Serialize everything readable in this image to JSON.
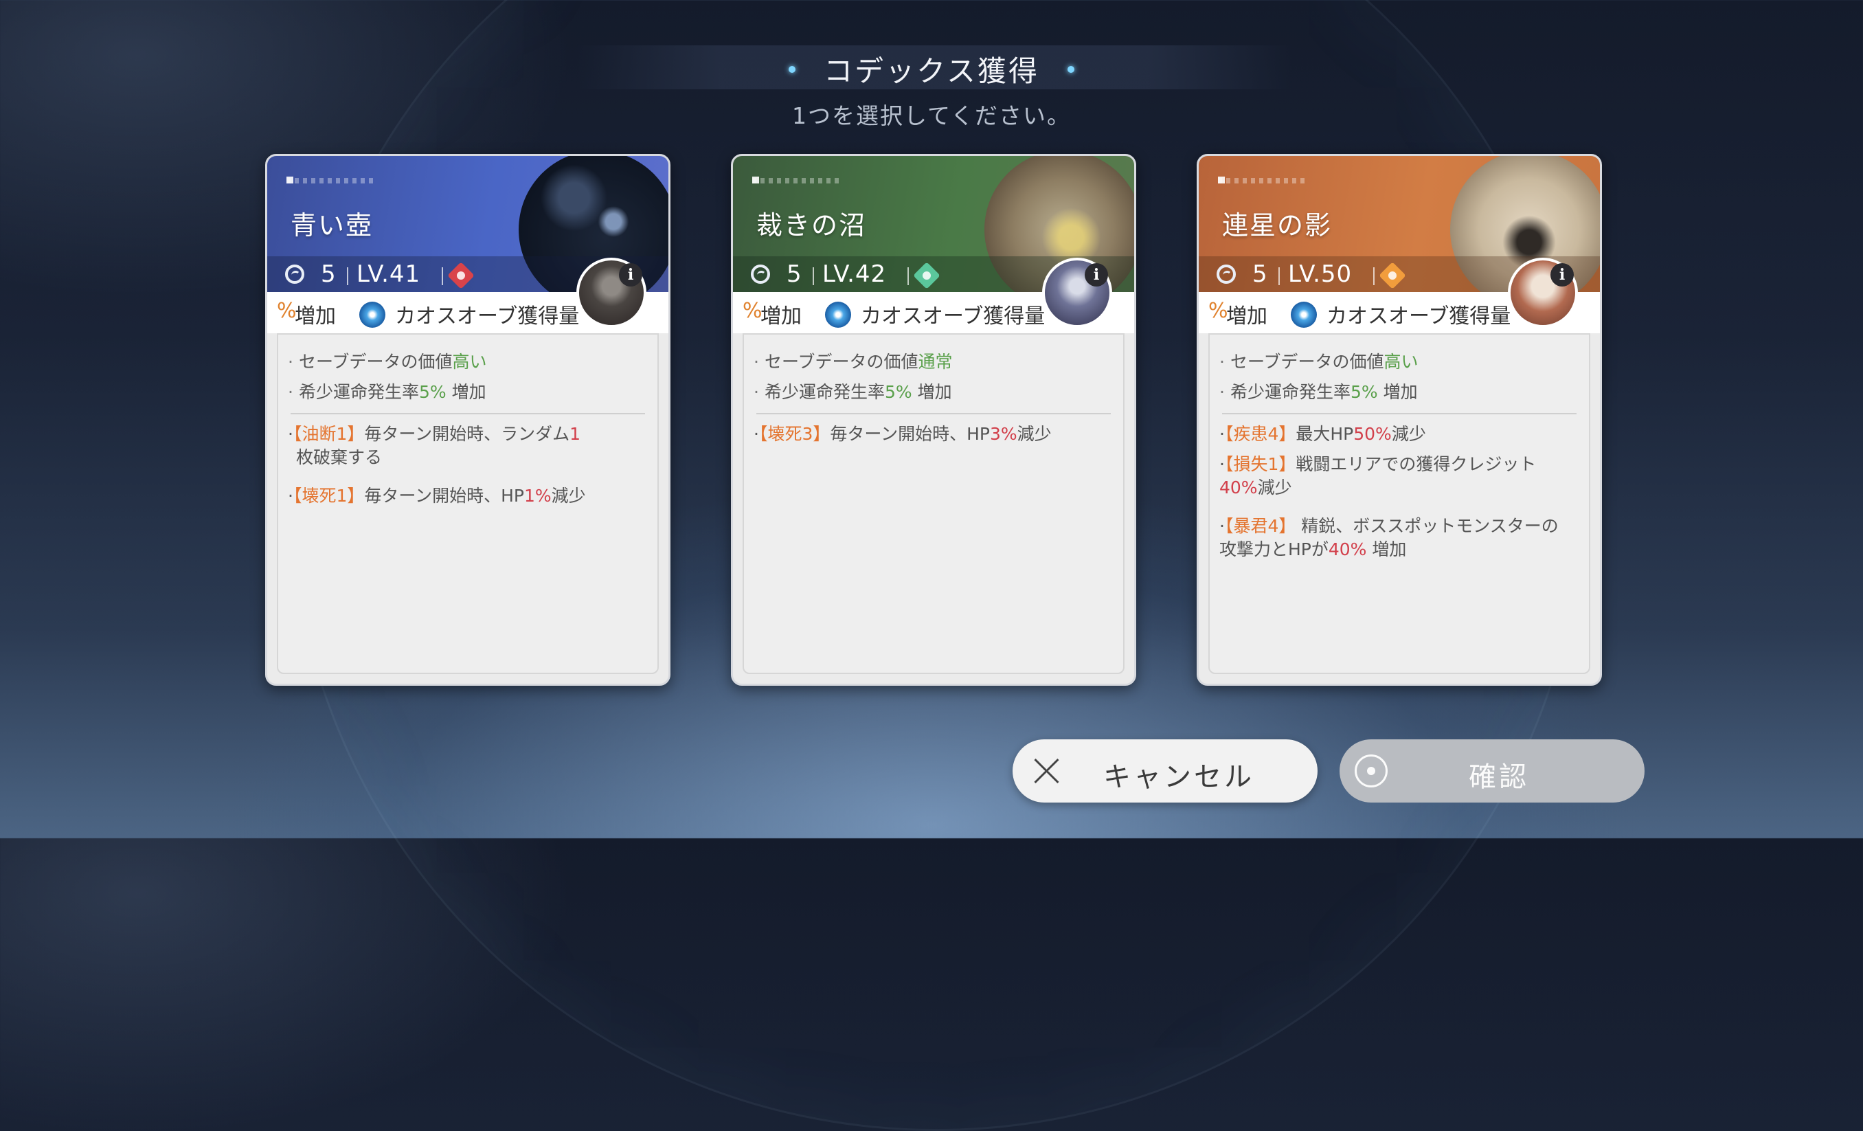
{
  "header": {
    "title": "コデックス獲得",
    "subtitle": "1つを選択してください。"
  },
  "cards": [
    {
      "name": "青い壺",
      "rarity": "5",
      "level": "LV.41",
      "element_color": "#d9434a",
      "strip_pct": "%",
      "strip_increase": "増加",
      "strip_text": "カオスオーブ獲得量",
      "stat1_prefix": "セーブデータの価値",
      "stat1_value": "高い",
      "stat2_prefix": "希少運命発生率",
      "stat2_value": "5%",
      "stat2_suffix": " 増加",
      "effects": [
        {
          "tag": "【油断1】",
          "text_a": "毎ターン開始時、ランダム",
          "value": "1",
          "text_b": "枚破棄する"
        },
        {
          "tag": "【壊死1】",
          "text_a": "毎ターン開始時、HP",
          "value": "1%",
          "text_b": "減少"
        }
      ]
    },
    {
      "name": "裁きの沼",
      "rarity": "5",
      "level": "LV.42",
      "element_color": "#5bc79c",
      "strip_pct": "%",
      "strip_increase": "増加",
      "strip_text": "カオスオーブ獲得量",
      "stat1_prefix": "セーブデータの価値",
      "stat1_value": "通常",
      "stat2_prefix": "希少運命発生率",
      "stat2_value": "5%",
      "stat2_suffix": " 増加",
      "effects": [
        {
          "tag": "【壊死3】",
          "text_a": "毎ターン開始時、HP",
          "value": "3%",
          "text_b": "減少"
        }
      ]
    },
    {
      "name": "連星の影",
      "rarity": "5",
      "level": "LV.50",
      "element_color": "#f29d3c",
      "strip_pct": "%",
      "strip_increase": "増加",
      "strip_text": "カオスオーブ獲得量",
      "stat1_prefix": "セーブデータの価値",
      "stat1_value": "高い",
      "stat2_prefix": "希少運命発生率",
      "stat2_value": "5%",
      "stat2_suffix": " 増加",
      "effects": [
        {
          "tag": "【疾患4】",
          "text_a": "最大HP",
          "value": "50%",
          "text_b": "減少"
        },
        {
          "tag": "【損失1】",
          "text_a": "戦闘エリアでの獲得クレジット",
          "value": "40%",
          "text_b": "減少"
        },
        {
          "tag": "【暴君4】",
          "text_a": " 精鋭、ボススポットモンスターの攻撃力とHPが",
          "value": "40%",
          "text_b": " 増加"
        }
      ]
    }
  ],
  "buttons": {
    "cancel": "キャンセル",
    "confirm": "確認"
  },
  "icons": {
    "rarity": "spiral-icon",
    "info": "i",
    "cancel": "close-icon",
    "confirm": "target-circle-icon"
  }
}
